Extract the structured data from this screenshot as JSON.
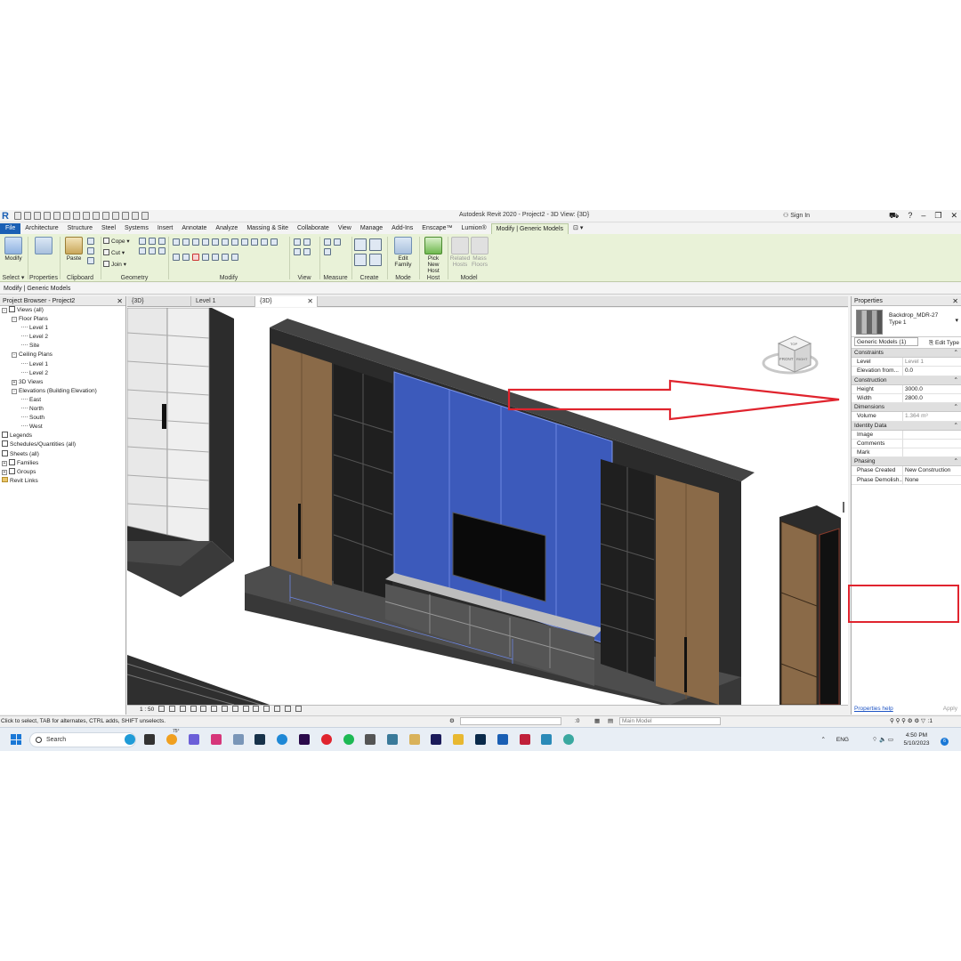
{
  "app": {
    "title": "Autodesk Revit 2020 - Project2 - 3D View: {3D}",
    "sign_in": "Sign In"
  },
  "ribbon_tabs": [
    "File",
    "Architecture",
    "Structure",
    "Steel",
    "Systems",
    "Insert",
    "Annotate",
    "Analyze",
    "Massing & Site",
    "Collaborate",
    "View",
    "Manage",
    "Add-Ins",
    "Enscape™",
    "Lumion®",
    "Modify | Generic Models"
  ],
  "ribbon": {
    "select": {
      "modify": "Modify",
      "label": "Select ▾"
    },
    "properties": {
      "label": "Properties"
    },
    "clipboard": {
      "paste": "Paste",
      "label": "Clipboard"
    },
    "geometry": {
      "cope": "Cope",
      "cut": "Cut",
      "join": "Join",
      "label": "Geometry"
    },
    "modify_label": "Modify",
    "view_label": "View",
    "measure_label": "Measure",
    "create_label": "Create",
    "mode": {
      "edit_family": "Edit Family",
      "label": "Mode"
    },
    "host": {
      "pick_new_host": "Pick New Host",
      "label": "Host"
    },
    "model": {
      "related_hosts": "Related Hosts",
      "mass_floors": "Mass Floors",
      "label": "Model"
    }
  },
  "options_bar": "Modify | Generic Models",
  "project_browser": {
    "title": "Project Browser - Project2",
    "items": [
      {
        "label": "Views (all)",
        "depth": 0,
        "toggle": "-",
        "kind": "view"
      },
      {
        "label": "Floor Plans",
        "depth": 1,
        "toggle": "-",
        "kind": "none"
      },
      {
        "label": "Level 1",
        "depth": 2,
        "toggle": "",
        "kind": "leaf"
      },
      {
        "label": "Level 2",
        "depth": 2,
        "toggle": "",
        "kind": "leaf"
      },
      {
        "label": "Site",
        "depth": 2,
        "toggle": "",
        "kind": "leaf"
      },
      {
        "label": "Ceiling Plans",
        "depth": 1,
        "toggle": "-",
        "kind": "none"
      },
      {
        "label": "Level 1",
        "depth": 2,
        "toggle": "",
        "kind": "leaf"
      },
      {
        "label": "Level 2",
        "depth": 2,
        "toggle": "",
        "kind": "leaf"
      },
      {
        "label": "3D Views",
        "depth": 1,
        "toggle": "+",
        "kind": "none"
      },
      {
        "label": "Elevations (Building Elevation)",
        "depth": 1,
        "toggle": "-",
        "kind": "none"
      },
      {
        "label": "East",
        "depth": 2,
        "toggle": "",
        "kind": "leaf"
      },
      {
        "label": "North",
        "depth": 2,
        "toggle": "",
        "kind": "leaf"
      },
      {
        "label": "South",
        "depth": 2,
        "toggle": "",
        "kind": "leaf"
      },
      {
        "label": "West",
        "depth": 2,
        "toggle": "",
        "kind": "leaf"
      },
      {
        "label": "Legends",
        "depth": 0,
        "toggle": "",
        "kind": "list"
      },
      {
        "label": "Schedules/Quantities (all)",
        "depth": 0,
        "toggle": "",
        "kind": "list"
      },
      {
        "label": "Sheets (all)",
        "depth": 0,
        "toggle": "",
        "kind": "list"
      },
      {
        "label": "Families",
        "depth": 0,
        "toggle": "+",
        "kind": "folder"
      },
      {
        "label": "Groups",
        "depth": 0,
        "toggle": "+",
        "kind": "folder"
      },
      {
        "label": "Revit Links",
        "depth": 0,
        "toggle": "",
        "kind": "link"
      }
    ]
  },
  "view_tabs": [
    {
      "label": "{3D}",
      "active": false
    },
    {
      "label": "Level 1",
      "active": false
    },
    {
      "label": "{3D}",
      "active": true
    }
  ],
  "view_control_bar": {
    "scale": "1 : 50"
  },
  "properties": {
    "title": "Properties",
    "type_family": "Backdrop_MDR-27",
    "type_name": "Type 1",
    "instance_filter": "Generic Models (1)",
    "edit_type": "Edit Type",
    "groups": [
      {
        "name": "Constraints",
        "rows": [
          {
            "key": "Level",
            "value": "Level 1",
            "grey": true
          },
          {
            "key": "Elevation from...",
            "value": "0.0",
            "grey": false
          }
        ]
      },
      {
        "name": "Construction",
        "rows": [
          {
            "key": "Height",
            "value": "3000.0",
            "grey": false
          },
          {
            "key": "Width",
            "value": "2800.0",
            "grey": false
          }
        ]
      },
      {
        "name": "Dimensions",
        "rows": [
          {
            "key": "Volume",
            "value": "1.364 m³",
            "grey": true
          }
        ]
      },
      {
        "name": "Identity Data",
        "rows": [
          {
            "key": "Image",
            "value": "",
            "grey": false
          },
          {
            "key": "Comments",
            "value": "",
            "grey": false
          },
          {
            "key": "Mark",
            "value": "",
            "grey": false
          }
        ]
      },
      {
        "name": "Phasing",
        "rows": [
          {
            "key": "Phase Created",
            "value": "New Construction",
            "grey": false
          },
          {
            "key": "Phase Demolish...",
            "value": "None",
            "grey": false
          }
        ]
      }
    ],
    "help": "Properties help",
    "apply": "Apply"
  },
  "status_bar": {
    "message": "Click to select, TAB for alternates, CTRL adds, SHIFT unselects.",
    "workset_count": ":0",
    "model": "Main Model",
    "filter_count": ":1"
  },
  "viewcube": {
    "front": "FRONT",
    "top": "TOP",
    "right": "RIGHT"
  },
  "taskbar": {
    "search": "Search",
    "lang": "ENG",
    "time": "4:50 PM",
    "date": "5/10/2023",
    "weather": "75°",
    "notifications": "6"
  },
  "colors": {
    "revit_blue": "#1a5fb4",
    "ribbon_green": "#e9f2d8",
    "selection_blue": "#3e5ec8",
    "annotation_red": "#e0242e"
  }
}
